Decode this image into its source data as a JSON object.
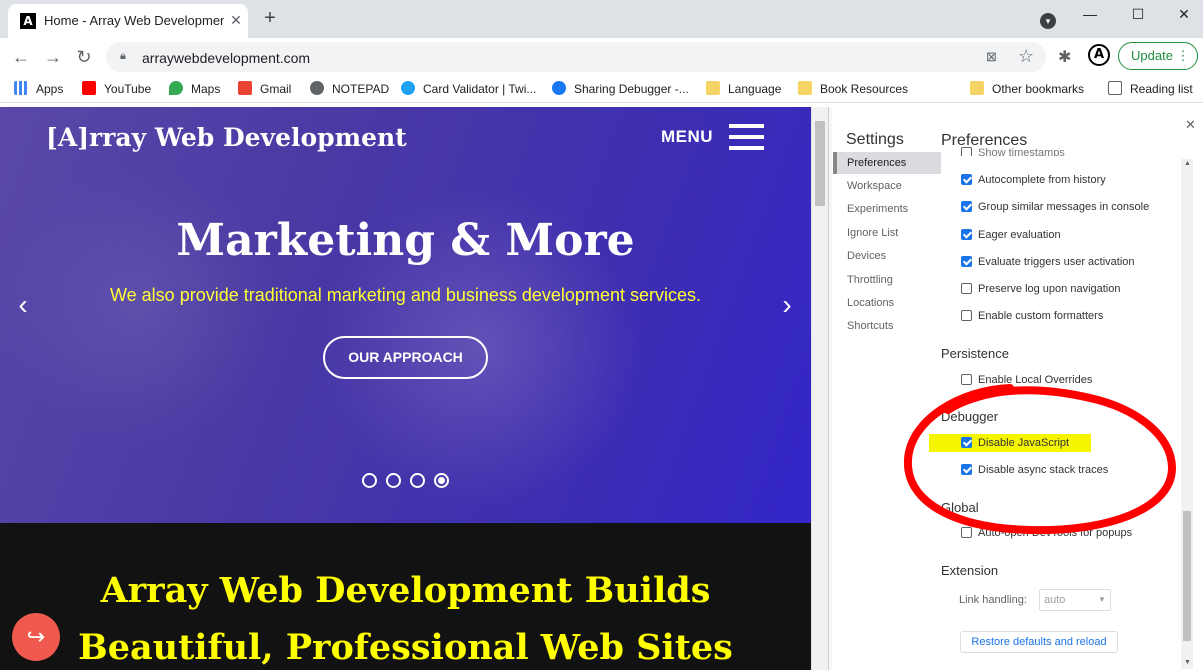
{
  "browser": {
    "tab_title": "Home - Array Web Development",
    "tab_favicon": "A",
    "url": "arraywebdevelopment.com",
    "update_label": "Update",
    "profile_letter": "A"
  },
  "bookmarks": [
    {
      "label": "Apps",
      "icon": "apps-grid-icon",
      "color": "#4285f4"
    },
    {
      "label": "YouTube",
      "icon": "youtube-icon",
      "color": "#ff0000"
    },
    {
      "label": "Maps",
      "icon": "maps-pin-icon",
      "color": "#34a853"
    },
    {
      "label": "Gmail",
      "icon": "gmail-icon",
      "color": "#ea4335"
    },
    {
      "label": "NOTEPAD",
      "icon": "globe-icon",
      "color": "#5f6368"
    },
    {
      "label": "Card Validator | Twi...",
      "icon": "twitter-icon",
      "color": "#1da1f2"
    },
    {
      "label": "Sharing Debugger -...",
      "icon": "facebook-icon",
      "color": "#1877f2"
    },
    {
      "label": "Language",
      "icon": "folder-icon",
      "color": "#f6d365"
    },
    {
      "label": "Book Resources",
      "icon": "folder-icon",
      "color": "#f6d365"
    },
    {
      "label": "Other bookmarks",
      "icon": "folder-icon",
      "color": "#f6d365"
    },
    {
      "label": "Reading list",
      "icon": "reading-list-icon",
      "color": "#5f6368"
    }
  ],
  "site": {
    "logo": "[A]rray Web Development",
    "menu_label": "MENU",
    "hero_title": "Marketing & More",
    "hero_subtitle": "We also provide traditional marketing and business development services.",
    "hero_button": "OUR APPROACH",
    "slide_active": 4,
    "slide_count": 4,
    "section_title_line1": "Array Web Development Builds",
    "section_title_line2": "Beautiful, Professional Web Sites"
  },
  "devtools": {
    "settings_title": "Settings",
    "panel_title": "Preferences",
    "nav": [
      "Preferences",
      "Workspace",
      "Experiments",
      "Ignore List",
      "Devices",
      "Throttling",
      "Locations",
      "Shortcuts"
    ],
    "console_options": [
      {
        "label": "Show timestamps",
        "checked": false
      },
      {
        "label": "Autocomplete from history",
        "checked": true
      },
      {
        "label": "Group similar messages in console",
        "checked": true
      },
      {
        "label": "Eager evaluation",
        "checked": true
      },
      {
        "label": "Evaluate triggers user activation",
        "checked": true
      },
      {
        "label": "Preserve log upon navigation",
        "checked": false
      },
      {
        "label": "Enable custom formatters",
        "checked": false
      }
    ],
    "persistence_title": "Persistence",
    "persistence_options": [
      {
        "label": "Enable Local Overrides",
        "checked": false
      }
    ],
    "debugger_title": "Debugger",
    "debugger_options": [
      {
        "label": "Disable JavaScript",
        "checked": true,
        "highlighted": true
      },
      {
        "label": "Disable async stack traces",
        "checked": true
      }
    ],
    "global_title": "Global",
    "global_options": [
      {
        "label": "Auto-open DevTools for popups",
        "checked": false
      }
    ],
    "extension_title": "Extension",
    "link_handling_label": "Link handling:",
    "link_handling_value": "auto",
    "restore_button": "Restore defaults and reload"
  },
  "colors": {
    "hero_subtitle": "#ffff33",
    "section_title": "#ffff00",
    "annotation_circle": "#ff0000",
    "highlight": "#f5f500",
    "checkbox_checked": "#1a73e8"
  }
}
